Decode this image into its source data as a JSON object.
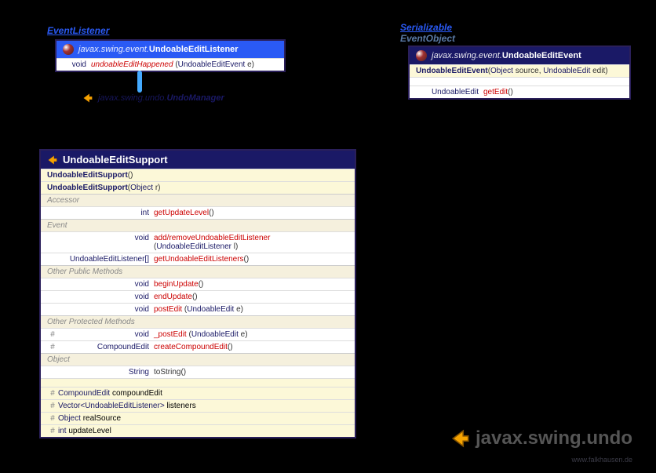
{
  "listener": {
    "interfaceLabel": "EventListener",
    "package": "javax.swing.event.",
    "className": "UndoableEditListener",
    "method": {
      "ret": "void",
      "name": "undoableEditHappened",
      "paramType": "UndoableEditEvent",
      "paramName": "e"
    },
    "subclass": {
      "package": "javax.swing.undo.",
      "className": "UndoManager"
    }
  },
  "event": {
    "interfaceLabel": "Serializable",
    "superclassLabel": "EventObject",
    "package": "javax.swing.event.",
    "className": "UndoableEditEvent",
    "constructor": {
      "name": "UndoableEditEvent",
      "p1Type": "Object",
      "p1Name": "source",
      "p2Type": "UndoableEdit",
      "p2Name": "edit"
    },
    "getter": {
      "ret": "UndoableEdit",
      "name": "getEdit"
    }
  },
  "support": {
    "className": "UndoableEditSupport",
    "ctors": [
      {
        "name": "UndoableEditSupport",
        "params": "()"
      },
      {
        "name": "UndoableEditSupport",
        "paramsType": "Object",
        "paramsName": "r"
      }
    ],
    "sections": {
      "accessor": "Accessor",
      "event": "Event",
      "otherPublic": "Other Public Methods",
      "otherProtected": "Other Protected Methods",
      "object": "Object"
    },
    "accessor": {
      "ret": "int",
      "name": "getUpdateLevel"
    },
    "eventMethods": [
      {
        "ret": "void",
        "name": "add/removeUndoableEditListener",
        "pType": "UndoableEditListener",
        "pName": "l"
      },
      {
        "ret": "UndoableEditListener[]",
        "name": "getUndoableEditListeners",
        "params": "()"
      }
    ],
    "publicMethods": [
      {
        "ret": "void",
        "name": "beginUpdate"
      },
      {
        "ret": "void",
        "name": "endUpdate"
      },
      {
        "ret": "void",
        "name": "postEdit",
        "pType": "UndoableEdit",
        "pName": "e"
      }
    ],
    "protectedMethods": [
      {
        "ret": "void",
        "name": "_postEdit",
        "pType": "UndoableEdit",
        "pName": "e"
      },
      {
        "ret": "CompoundEdit",
        "name": "createCompoundEdit"
      }
    ],
    "objectMethods": [
      {
        "ret": "String",
        "name": "toString"
      }
    ],
    "fields": [
      {
        "type": "CompoundEdit",
        "name": "compoundEdit"
      },
      {
        "typePrefix": "Vector<",
        "typeGeneric": "UndoableEditListener",
        "typeSuffix": ">",
        "name": "listeners"
      },
      {
        "type": "Object",
        "name": "realSource"
      },
      {
        "type": "int",
        "name": "updateLevel"
      }
    ]
  },
  "packageLabel": "javax.swing.undo",
  "credit": "www.falkhausen.de"
}
